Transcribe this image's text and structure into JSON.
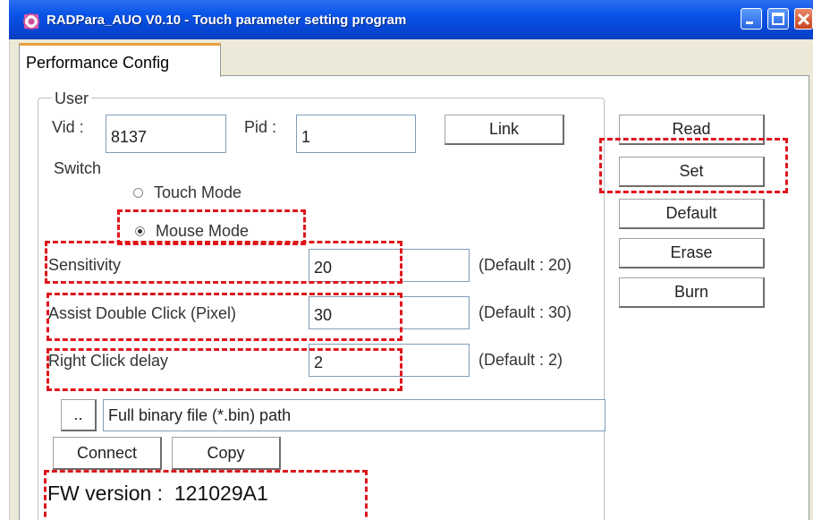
{
  "window": {
    "title": "RADPara_AUO V0.10 - Touch parameter setting program",
    "icon": "gear-flower-icon"
  },
  "title_buttons": {
    "minimize": "minimize-icon",
    "maximize": "maximize-icon",
    "close": "close-icon"
  },
  "tab": {
    "label": "Performance Config"
  },
  "user_group": {
    "label": "User"
  },
  "vid": {
    "label": "Vid :",
    "value": "8137"
  },
  "pid": {
    "label": "Pid :",
    "value": "1"
  },
  "buttons": {
    "link": "Link",
    "read": "Read",
    "set": "Set",
    "default": "Default",
    "erase": "Erase",
    "burn": "Burn",
    "browse": "..",
    "connect": "Connect",
    "copy": "Copy"
  },
  "switch": {
    "label": "Switch",
    "touch_mode": "Touch Mode",
    "mouse_mode": "Mouse Mode",
    "selected": "Mouse Mode"
  },
  "sensitivity": {
    "label": "Sensitivity",
    "value": "20",
    "default": "(Default : 20)"
  },
  "assist_double_click": {
    "label": "Assist Double Click (Pixel)",
    "value": "30",
    "default": "(Default : 30)"
  },
  "right_click_delay": {
    "label": "Right Click delay",
    "value": "2",
    "default": "(Default : 2)"
  },
  "file": {
    "path": "Full binary file (*.bin) path"
  },
  "fw": {
    "label": "FW version :",
    "value": "121029A1"
  },
  "colors": {
    "titlebar": "#0a55e8",
    "highlight": "#e0151b",
    "tab_accent": "#e8a040"
  }
}
